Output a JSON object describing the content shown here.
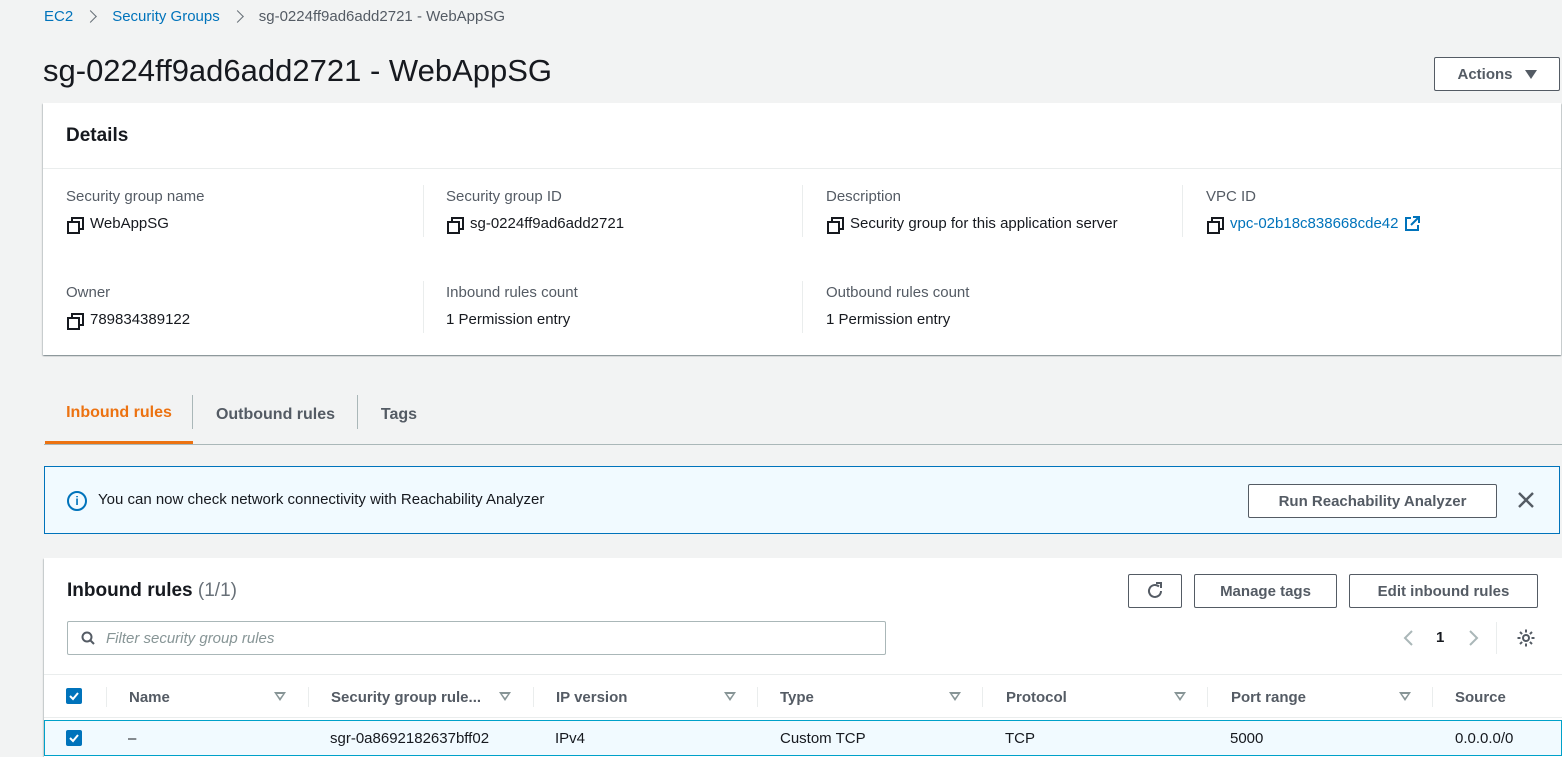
{
  "breadcrumb": {
    "root": "EC2",
    "section": "Security Groups",
    "current": "sg-0224ff9ad6add2721 - WebAppSG"
  },
  "page": {
    "title": "sg-0224ff9ad6add2721 - WebAppSG",
    "actions_label": "Actions"
  },
  "details": {
    "heading": "Details",
    "fields": {
      "sg_name": {
        "label": "Security group name",
        "value": "WebAppSG"
      },
      "sg_id": {
        "label": "Security group ID",
        "value": "sg-0224ff9ad6add2721"
      },
      "description": {
        "label": "Description",
        "value": "Security group for this application server"
      },
      "vpc_id": {
        "label": "VPC ID",
        "value": "vpc-02b18c838668cde42"
      },
      "owner": {
        "label": "Owner",
        "value": "789834389122"
      },
      "inbound_count": {
        "label": "Inbound rules count",
        "value": "1 Permission entry"
      },
      "outbound_count": {
        "label": "Outbound rules count",
        "value": "1 Permission entry"
      }
    }
  },
  "tabs": [
    {
      "label": "Inbound rules",
      "active": true
    },
    {
      "label": "Outbound rules",
      "active": false
    },
    {
      "label": "Tags",
      "active": false
    }
  ],
  "alert": {
    "text": "You can now check network connectivity with Reachability Analyzer",
    "button": "Run Reachability Analyzer"
  },
  "rules": {
    "title": "Inbound rules",
    "count": "(1/1)",
    "manage_tags": "Manage tags",
    "edit_rules": "Edit inbound rules",
    "search_placeholder": "Filter security group rules",
    "page_number": "1",
    "columns": [
      "Name",
      "Security group rule...",
      "IP version",
      "Type",
      "Protocol",
      "Port range",
      "Source"
    ],
    "rows": [
      {
        "name": "–",
        "rule_id": "sgr-0a8692182637bff02",
        "ip_version": "IPv4",
        "type": "Custom TCP",
        "protocol": "TCP",
        "port_range": "5000",
        "source": "0.0.0.0/0"
      }
    ]
  },
  "colors": {
    "link": "#0073bb",
    "active_tab": "#ec7211",
    "info_bg": "#f1faff"
  }
}
